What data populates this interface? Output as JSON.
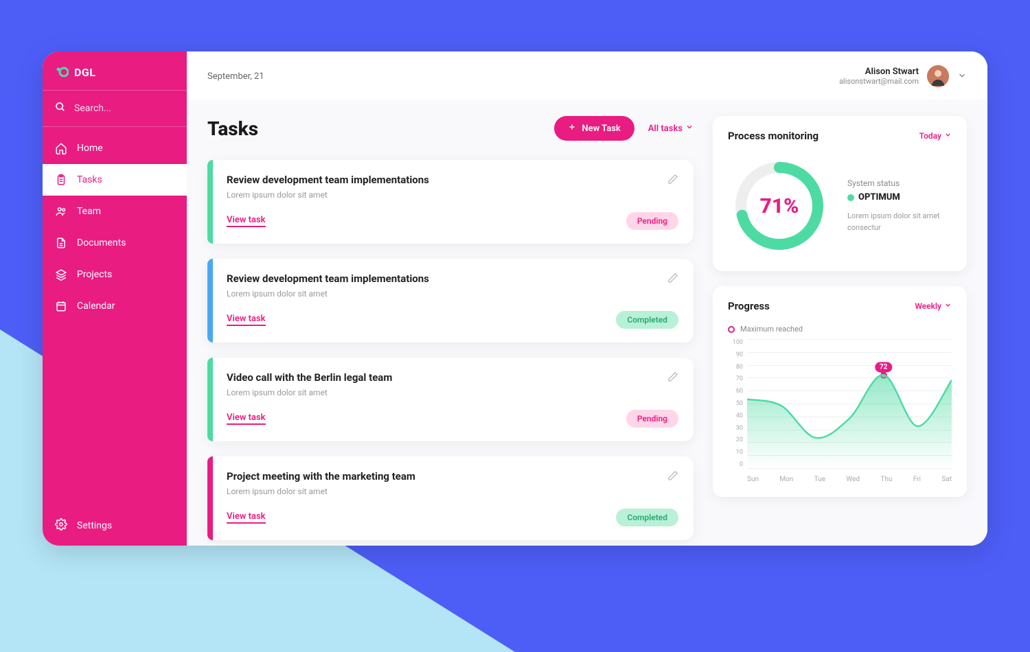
{
  "brand": "DGL",
  "search_placeholder": "Search...",
  "nav": [
    {
      "label": "Home",
      "icon": "home"
    },
    {
      "label": "Tasks",
      "icon": "clipboard",
      "active": true
    },
    {
      "label": "Team",
      "icon": "team"
    },
    {
      "label": "Documents",
      "icon": "document"
    },
    {
      "label": "Projects",
      "icon": "layers"
    },
    {
      "label": "Calendar",
      "icon": "calendar"
    }
  ],
  "settings_label": "Settings",
  "header": {
    "date": "September, 21",
    "user_name": "Alison Stwart",
    "user_email": "alisonstwart@mail.com"
  },
  "tasks_section": {
    "title": "Tasks",
    "new_task_label": "New Task",
    "filter_label": "All tasks",
    "view_task_label": "View task",
    "items": [
      {
        "title": "Review development team implementations",
        "subtitle": "Lorem ipsum dolor sit amet",
        "status": "Pending",
        "status_type": "pending",
        "stripe": "#4ddba3"
      },
      {
        "title": "Review development team implementations",
        "subtitle": "Lorem ipsum dolor sit amet",
        "status": "Completed",
        "status_type": "completed",
        "stripe": "#4aa8f0"
      },
      {
        "title": "Video call with the Berlin legal team",
        "subtitle": "Lorem ipsum dolor sit amet",
        "status": "Pending",
        "status_type": "pending",
        "stripe": "#4ddba3"
      },
      {
        "title": "Project meeting with the marketing team",
        "subtitle": "Lorem ipsum dolor sit amet",
        "status": "Completed",
        "status_type": "completed",
        "stripe": "#e91c82"
      }
    ]
  },
  "process_panel": {
    "title": "Process monitoring",
    "filter": "Today",
    "percent": 71,
    "percent_text": "71%",
    "status_label": "System status",
    "status_value": "OPTIMUM",
    "status_desc": "Lorem ipsum dolor sit amet consectur"
  },
  "progress_panel": {
    "title": "Progress",
    "filter": "Weekly",
    "legend": "Maximum reached",
    "peak_value": 72
  },
  "chart_data": {
    "type": "area",
    "title": "Progress",
    "legend": [
      "Maximum reached"
    ],
    "xlabel": "",
    "ylabel": "",
    "ylim": [
      0,
      100
    ],
    "yticks": [
      0,
      10,
      20,
      30,
      40,
      50,
      60,
      70,
      80,
      90,
      100
    ],
    "categories": [
      "Sun",
      "Mon",
      "Tue",
      "Wed",
      "Thu",
      "Fri",
      "Sat"
    ],
    "values": [
      53,
      48,
      23,
      38,
      72,
      32,
      68
    ],
    "highlight": {
      "category": "Thu",
      "value": 72
    }
  },
  "colors": {
    "accent_pink": "#e91c82",
    "accent_green": "#4ddba3",
    "accent_blue": "#4aa8f0"
  }
}
